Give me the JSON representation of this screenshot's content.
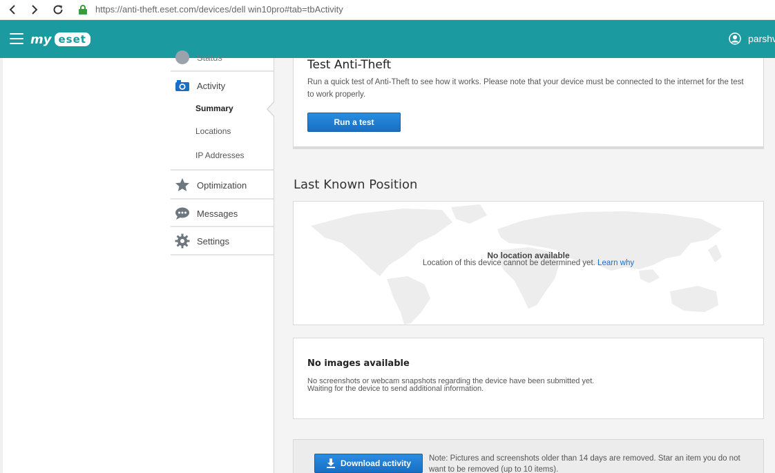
{
  "browser": {
    "url": "https://anti-theft.eset.com/devices/dell win10pro#tab=tbActivity"
  },
  "header": {
    "logo_my": "my",
    "logo_eset": "eset",
    "username": "parshv"
  },
  "sidebar": {
    "partial_item": "Status",
    "items": [
      {
        "label": "Activity",
        "icon": "camera-icon"
      },
      {
        "label": "Optimization",
        "icon": "star-icon"
      },
      {
        "label": "Messages",
        "icon": "chat-icon"
      },
      {
        "label": "Settings",
        "icon": "gear-icon"
      }
    ],
    "sub_items": [
      {
        "label": "Summary",
        "active": true
      },
      {
        "label": "Locations",
        "active": false
      },
      {
        "label": "IP Addresses",
        "active": false
      }
    ]
  },
  "test_card": {
    "title": "Test Anti-Theft",
    "description": "Run a quick test of Anti-Theft to see how it works. Please note that your device must be connected to the internet for the test to work properly.",
    "button": "Run a test"
  },
  "position": {
    "title": "Last Known Position",
    "no_location": "No location available",
    "message": "Location of this device cannot be determined yet.",
    "link": "Learn why"
  },
  "images": {
    "title": "No images available",
    "line1": "No screenshots or webcam snapshots regarding the device have been submitted yet.",
    "line2": "Waiting for the device to send additional information."
  },
  "download": {
    "button": "Download activity",
    "note": "Note: Pictures and screenshots older than 14 days are removed. Star an item you do not want to be removed (up to 10 items)."
  },
  "colors": {
    "header": "#1b9aa0",
    "button": "#1870c5",
    "link": "#1a6fc4"
  }
}
